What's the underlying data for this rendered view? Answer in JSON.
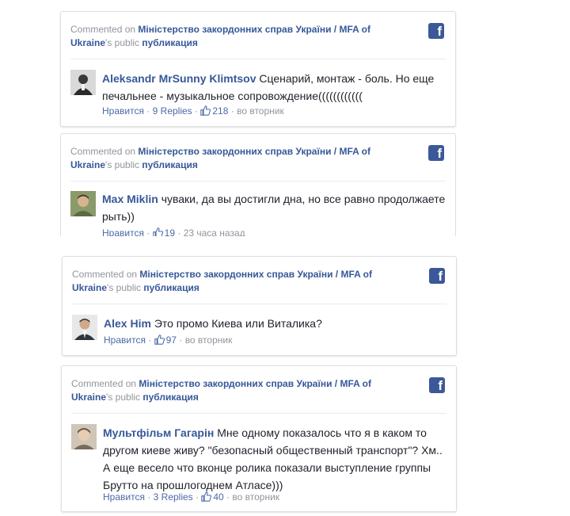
{
  "cards": [
    {
      "context_prefix": "Commented on",
      "page_name": "Міністерство закордонних справ України / MFA of Ukraine",
      "context_suffix": "'s",
      "context_public": "public",
      "context_post": "публикация",
      "author": "Aleksandr MrSunny Klimtsov",
      "text": "Сценарий, монтаж - боль. Но еще печальнее - музыкальное сопровождение((((((((((((",
      "like_link": "Нравится",
      "replies": "9 Replies",
      "likes": "218",
      "time": "во вторник"
    },
    {
      "context_prefix": "Commented on",
      "page_name": "Міністерство закордонних справ України / MFA of Ukraine",
      "context_suffix": "'s",
      "context_public": "public",
      "context_post": "публикация",
      "author": "Max Miklin",
      "text": "чуваки, да вы достигли дна, но все равно продолжаете рыть))",
      "like_link": "Нравится",
      "likes": "19",
      "time": "23 часа назад"
    },
    {
      "context_prefix": "Commented on",
      "page_name": "Міністерство закордонних справ України / MFA of Ukraine",
      "context_suffix": "'s",
      "context_public": "public",
      "context_post": "публикация",
      "author": "Alex Him",
      "text": "Это промо Киева или Виталика?",
      "like_link": "Нравится",
      "likes": "97",
      "time": "во вторник"
    },
    {
      "context_prefix": "Commented on",
      "page_name": "Міністерство закордонних справ України / MFA of Ukraine",
      "context_suffix": "'s",
      "context_public": "public",
      "context_post": "публикация",
      "author": "Мультфільм Гагарін",
      "text": "Мне одному показалось что я в каком то другом киеве живу? \"безопасный общественный транспорт\"? Хм.. А еще весело что вконце ролика показали выступление группы Брутто на прошлогоднем Атласе)))",
      "like_link": "Нравится",
      "replies": "3 Replies",
      "likes": "40",
      "time": "во вторник"
    }
  ],
  "colors": {
    "link": "#365899",
    "meta": "#90949c",
    "facebook": "#3b5998"
  },
  "icons": {
    "facebook": "f",
    "like": "thumbs-up-icon"
  }
}
